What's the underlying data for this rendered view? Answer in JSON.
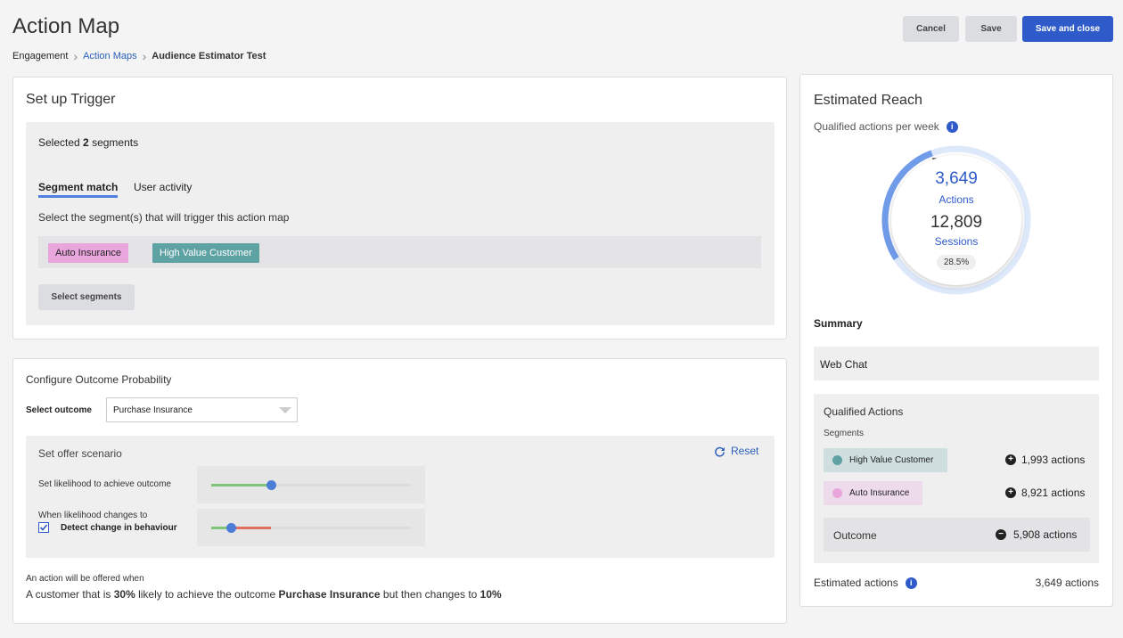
{
  "header": {
    "title": "Action Map",
    "breadcrumb": [
      "Engagement",
      "Action Maps",
      "Audience Estimator Test"
    ],
    "buttons": {
      "cancel": "Cancel",
      "save": "Save",
      "save_close": "Save and close"
    }
  },
  "trigger": {
    "title": "Set up Trigger",
    "selected_prefix": "Selected",
    "selected_count": "2",
    "selected_suffix": "segments",
    "tabs": [
      "Segment match",
      "User activity"
    ],
    "instruction": "Select the segment(s) that will trigger this action map",
    "chips": [
      {
        "label": "Auto Insurance",
        "color": "#e8a6dd"
      },
      {
        "label": "High Value Customer",
        "color": "#5fa2a4"
      }
    ],
    "select_button": "Select segments"
  },
  "outcome": {
    "title": "Configure Outcome Probability",
    "select_label": "Select outcome",
    "select_value": "Purchase Insurance",
    "scenario_title": "Set offer scenario",
    "reset_label": "Reset",
    "likelihood_label": "Set likelihood to achieve outcome",
    "likelihood_value": 0.3,
    "change_label": "When likelihood changes to",
    "detect_label": "Detect change in behaviour",
    "change_value": 0.1,
    "offered_label": "An action will be offered when",
    "sentence": {
      "p1": "A customer that is ",
      "b1": "30%",
      "p2": " likely to achieve the outcome ",
      "b2": "Purchase Insurance",
      "p3": " but then changes to ",
      "b3": "10%"
    }
  },
  "reach": {
    "title": "Estimated Reach",
    "subtitle": "Qualified actions per week",
    "actions_value": "3,649",
    "actions_label": "Actions",
    "sessions_value": "12,809",
    "sessions_label": "Sessions",
    "percent": "28.5%",
    "percent_value": 0.285,
    "summary_title": "Summary",
    "channel": "Web Chat",
    "qualified_title": "Qualified Actions",
    "segments_label": "Segments",
    "segments": [
      {
        "name": "High Value Customer",
        "actions": "1,993 actions",
        "color": "#5fa2a4"
      },
      {
        "name": "Auto Insurance",
        "actions": "8,921 actions",
        "color": "#e8a6dd"
      }
    ],
    "outcome_label": "Outcome",
    "outcome_actions": "5,908 actions",
    "estimated_label": "Estimated actions",
    "estimated_value": "3,649 actions"
  },
  "colors": {
    "accent": "#2e5bc9",
    "link": "#2b5fb8",
    "green": "#7fc47a",
    "red": "#e07060"
  },
  "icons": [
    "chevron-right-icon",
    "reset-icon",
    "checkbox-icon",
    "info-icon",
    "plus-circle-icon",
    "minus-circle-icon",
    "dropdown-arrow-icon"
  ]
}
